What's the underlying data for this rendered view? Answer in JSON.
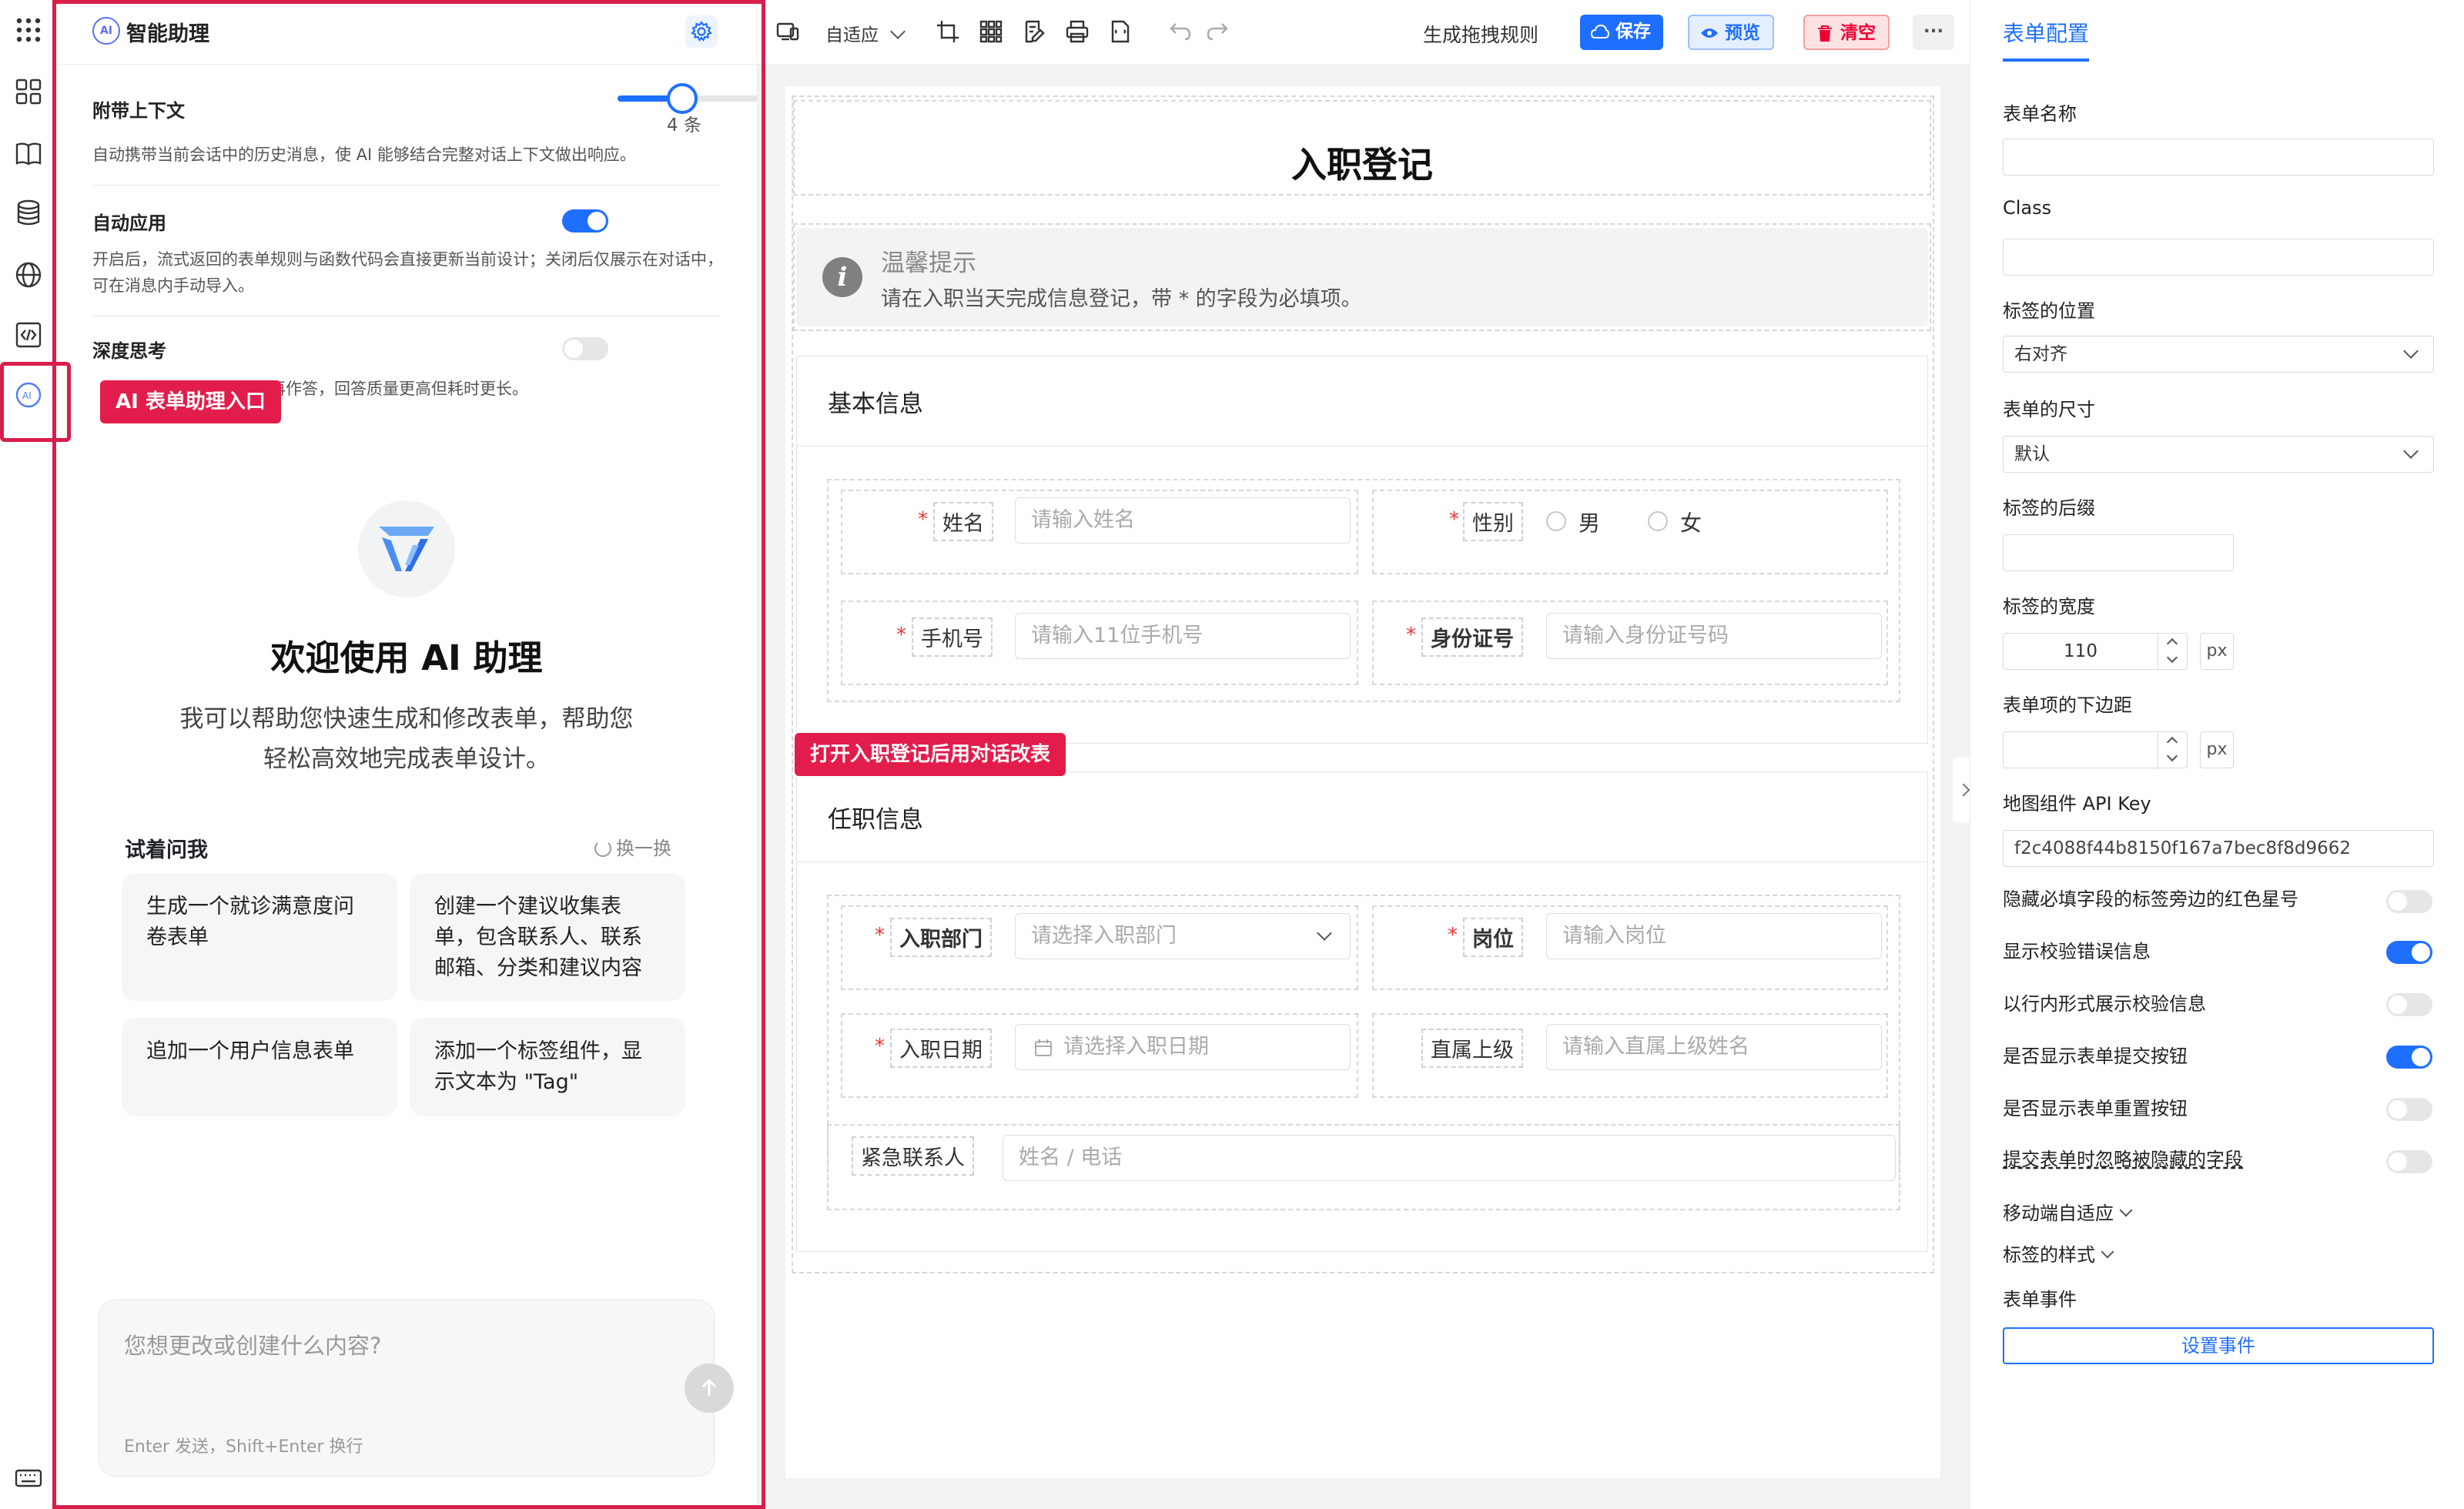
{
  "rail": {
    "icons": [
      "grid-dots-icon",
      "apps-icon",
      "book-icon",
      "database-icon",
      "globe-icon",
      "code-icon",
      "ai-icon",
      "keyboard-icon"
    ],
    "callout": "AI 表单助理入口"
  },
  "ai_panel": {
    "badge": "AI",
    "title": "智能助理",
    "context": {
      "label": "附带上下文",
      "value": 4,
      "max": 10,
      "count_text": "4 条",
      "desc": "自动携带当前会话中的历史消息，使 AI 能够结合完整对话上下文做出响应。"
    },
    "auto_apply": {
      "label": "自动应用",
      "enabled": true,
      "desc": "开启后，流式返回的表单规则与函数代码会直接更新当前设计；关闭后仅展示在对话中，可在消息内手动导入。"
    },
    "deep_think": {
      "label": "深度思考",
      "enabled": false,
      "desc_tail": "再作答，回答质量更高但耗时更长。"
    },
    "welcome_title": "欢迎使用 AI 助理",
    "welcome_sub": "我可以帮助您快速生成和修改表单，帮助您轻松高效地完成表单设计。",
    "try_label": "试着问我",
    "refresh_label": "换一换",
    "cards": [
      "生成一个就诊满意度问卷表单",
      "创建一个建议收集表单，包含联系人、联系邮箱、分类和建议内容",
      "追加一个用户信息表单",
      "添加一个标签组件，显示文本为 \"Tag\""
    ],
    "input_placeholder": "您想更改或创建什么内容?",
    "input_hint": "Enter 发送，Shift+Enter 换行"
  },
  "toolbar": {
    "adaptive": "自适应",
    "rule_label": "生成拖拽规则",
    "save": "保存",
    "preview": "预览",
    "clear": "清空",
    "more": "···",
    "colors": {
      "save_bg": "#1f6fff",
      "preview_bg": "#e6efff",
      "clear_bg": "#fde2e2",
      "accent": "#1f6fff"
    }
  },
  "form": {
    "title": "入职登记",
    "notice_title": "温馨提示",
    "notice_text": "请在入职当天完成信息登记，带 * 的字段为必填项。",
    "callout": "打开入职登记后用对话改表",
    "sections": [
      {
        "title": "基本信息",
        "fields": {
          "name": {
            "label": "姓名",
            "placeholder": "请输入姓名"
          },
          "gender": {
            "label": "性别",
            "options": [
              "男",
              "女"
            ]
          },
          "phone": {
            "label": "手机号",
            "placeholder": "请输入11位手机号"
          },
          "idcard": {
            "label": "身份证号",
            "placeholder": "请输入身份证号码"
          }
        }
      },
      {
        "title": "任职信息",
        "fields": {
          "dept": {
            "label": "入职部门",
            "placeholder": "请选择入职部门"
          },
          "post": {
            "label": "岗位",
            "placeholder": "请输入岗位"
          },
          "date": {
            "label": "入职日期",
            "placeholder": "请选择入职日期"
          },
          "manager": {
            "label": "直属上级",
            "placeholder": "请输入直属上级姓名"
          },
          "emergency": {
            "label": "紧急联系人",
            "placeholder": "姓名 / 电话"
          }
        }
      }
    ]
  },
  "right_panel": {
    "tab": "表单配置",
    "form_name": {
      "label": "表单名称",
      "value": ""
    },
    "class": {
      "label": "Class",
      "value": ""
    },
    "label_position": {
      "label": "标签的位置",
      "value": "右对齐"
    },
    "form_size": {
      "label": "表单的尺寸",
      "value": "默认"
    },
    "label_suffix": {
      "label": "标签的后缀",
      "value": ""
    },
    "label_width": {
      "label": "标签的宽度",
      "value": "110",
      "unit": "px"
    },
    "item_margin": {
      "label": "表单项的下边距",
      "value": "",
      "unit": "px"
    },
    "map_key": {
      "label": "地图组件 API Key",
      "value": "f2c4088f44b8150f167a7bec8f8d9662"
    },
    "toggles": [
      {
        "label": "隐藏必填字段的标签旁边的红色星号",
        "on": false
      },
      {
        "label": "显示校验错误信息",
        "on": true
      },
      {
        "label": "以行内形式展示校验信息",
        "on": false
      },
      {
        "label": "是否显示表单提交按钮",
        "on": true
      },
      {
        "label": "是否显示表单重置按钮",
        "on": false
      },
      {
        "label": "提交表单时忽略被隐藏的字段",
        "on": false
      }
    ],
    "mobile_adapt": "移动端自适应",
    "label_style": "标签的样式",
    "form_events": "表单事件",
    "set_events": "设置事件"
  }
}
